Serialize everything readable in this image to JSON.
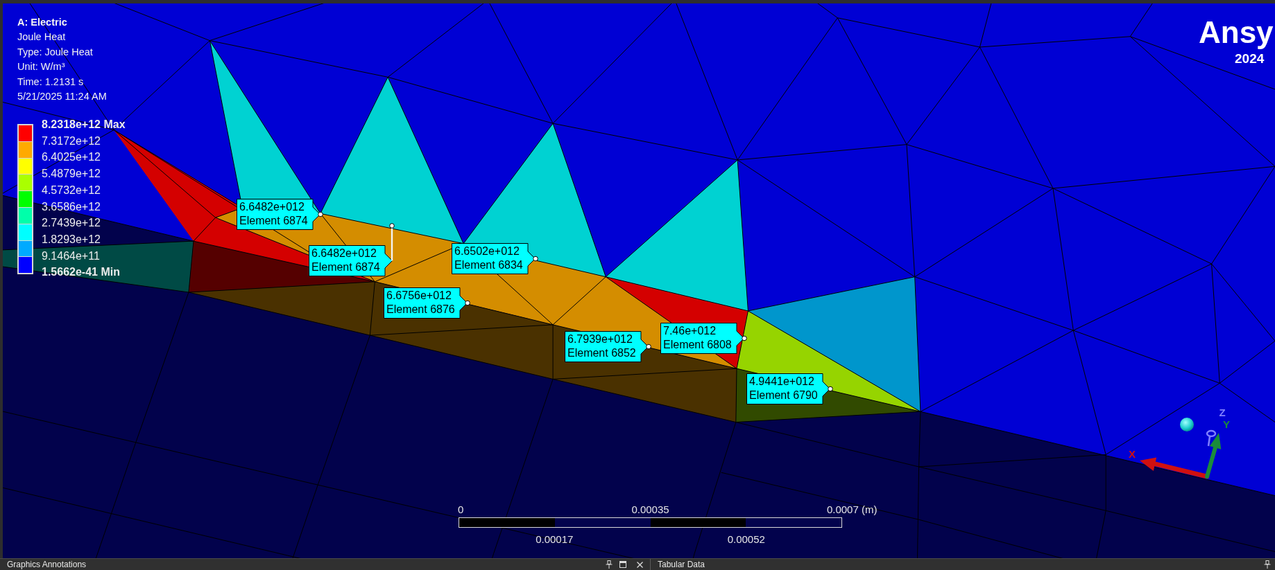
{
  "viewport": {
    "result": {
      "title": "A: Electric",
      "lines": [
        "Joule Heat",
        "Type: Joule Heat",
        "Unit: W/m³",
        "Time: 1.2131 s",
        "5/21/2025 11:24 AM"
      ]
    },
    "legend": {
      "bands": [
        {
          "color": "#ff0000"
        },
        {
          "color": "#ffaa00"
        },
        {
          "color": "#ffff00"
        },
        {
          "color": "#aaff00"
        },
        {
          "color": "#00ff00"
        },
        {
          "color": "#00ffaa"
        },
        {
          "color": "#00ffff"
        },
        {
          "color": "#00aaff"
        },
        {
          "color": "#0000ff"
        }
      ],
      "labels": [
        {
          "text": "8.2318e+12 Max",
          "kind": "max"
        },
        {
          "text": "7.3172e+12",
          "kind": "value"
        },
        {
          "text": "6.4025e+12",
          "kind": "value"
        },
        {
          "text": "5.4879e+12",
          "kind": "value"
        },
        {
          "text": "4.5732e+12",
          "kind": "value"
        },
        {
          "text": "3.6586e+12",
          "kind": "value"
        },
        {
          "text": "2.7439e+12",
          "kind": "value"
        },
        {
          "text": "1.8293e+12",
          "kind": "value"
        },
        {
          "text": "9.1464e+11",
          "kind": "value"
        },
        {
          "text": "1.5662e-41 Min",
          "kind": "min"
        }
      ]
    },
    "logo": {
      "wordmark": "Ansy",
      "version": "2024"
    },
    "probes": [
      {
        "value": "6.6482e+012",
        "element": "Element 6874",
        "leader": false
      },
      {
        "value": "6.6482e+012",
        "element": "Element 6874",
        "leader": true
      },
      {
        "value": "6.6502e+012",
        "element": "Element 6834",
        "leader": false
      },
      {
        "value": "6.6756e+012",
        "element": "Element 6876",
        "leader": false
      },
      {
        "value": "6.7939e+012",
        "element": "Element 6852",
        "leader": false
      },
      {
        "value": "7.46e+012",
        "element": "Element 6808",
        "leader": false
      },
      {
        "value": "4.9441e+012",
        "element": "Element 6790",
        "leader": false
      }
    ],
    "scale_bar": {
      "top_labels": [
        "0",
        "0.00035",
        "0.0007 (m)"
      ],
      "bottom_labels": [
        "0.00017",
        "0.00052"
      ]
    },
    "triad": {
      "axes": [
        {
          "label": "X",
          "color": "#d01010"
        },
        {
          "label": "Y",
          "color": "#1a8c3a"
        },
        {
          "label": "Z",
          "color": "#8080ff"
        }
      ]
    }
  },
  "panels": [
    {
      "title": "Graphics Annotations"
    },
    {
      "title": "Tabular Data"
    }
  ]
}
